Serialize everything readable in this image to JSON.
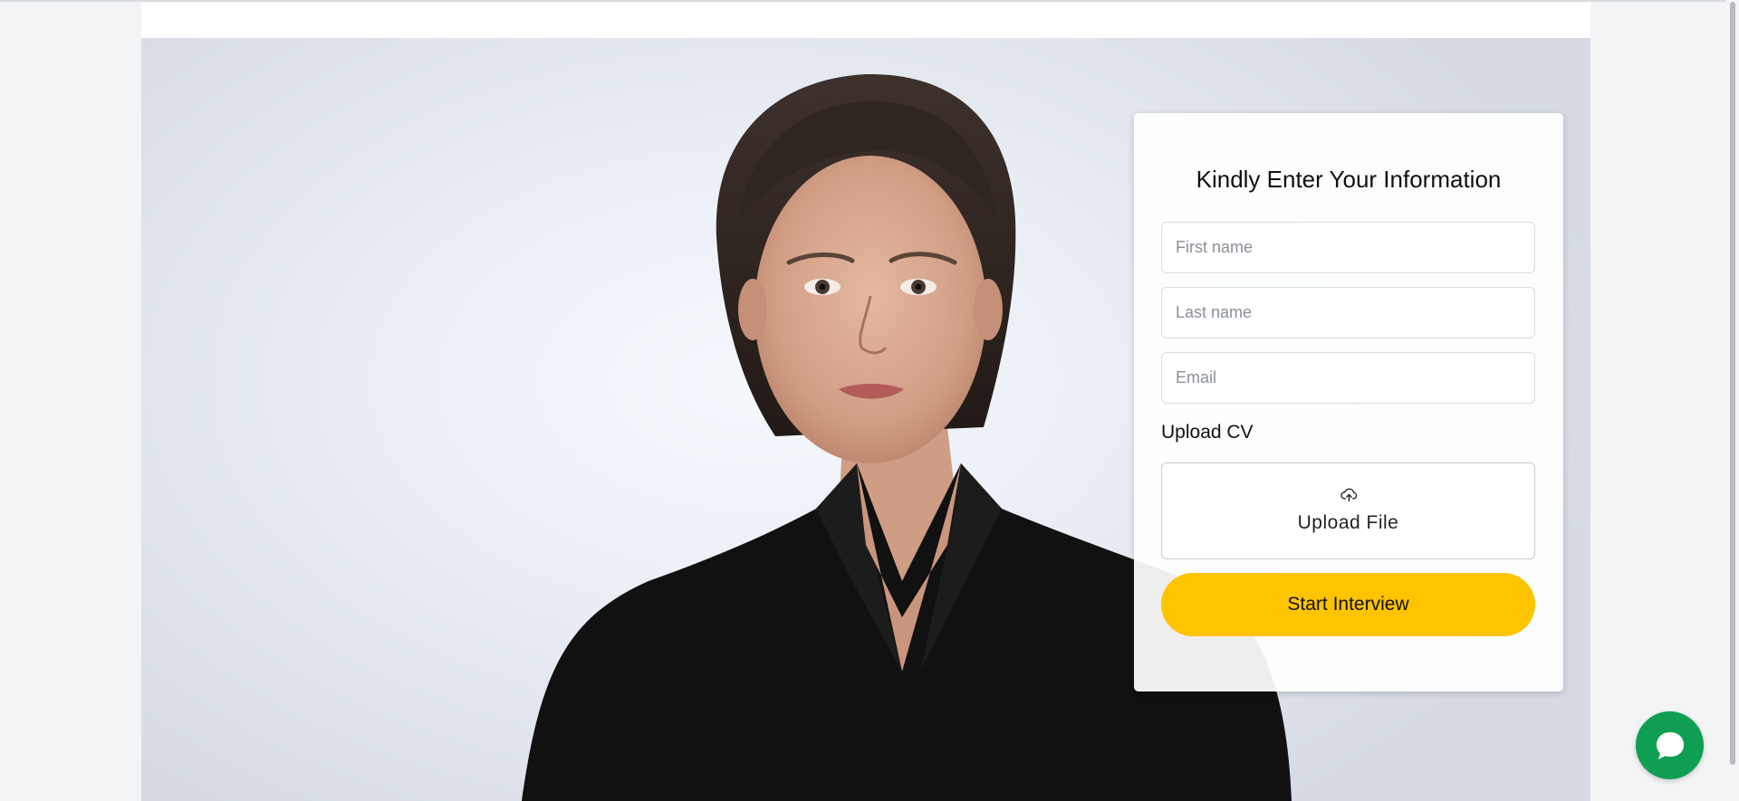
{
  "form": {
    "title": "Kindly Enter Your Information",
    "first_name_placeholder": "First name",
    "last_name_placeholder": "Last name",
    "email_placeholder": "Email",
    "upload_label": "Upload CV",
    "upload_button_label": "Upload File",
    "submit_label": "Start Interview"
  },
  "icons": {
    "upload": "cloud-upload-icon",
    "chat": "chat-bubble-icon"
  },
  "colors": {
    "accent": "#fec400",
    "chat": "#0e9f52"
  }
}
